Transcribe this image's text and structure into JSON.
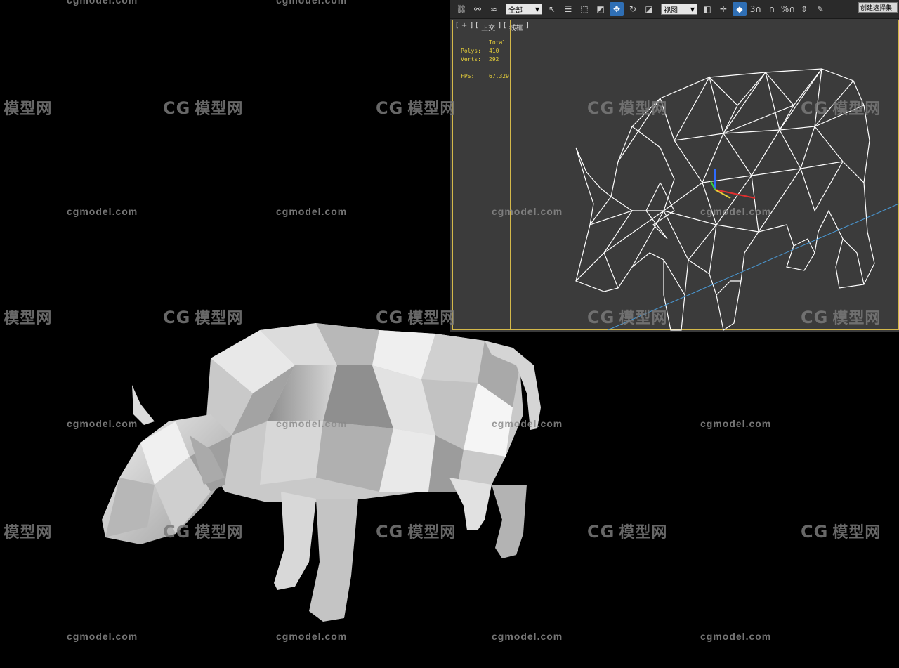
{
  "watermarks": {
    "cn": "模型网",
    "cn_logo": "CG",
    "en": "cgmodel.com"
  },
  "toolbar": {
    "selection_filter": "全部",
    "reference_coord": "视图",
    "snap_angle_label": "3",
    "percent_snap_label": "%",
    "named_selection": "创建选择集"
  },
  "viewport": {
    "label_parts": [
      "[",
      "+",
      "]",
      "[",
      "正交",
      "]",
      "[",
      "线框",
      "]"
    ],
    "stats": {
      "header": "Total",
      "polys_label": "Polys:",
      "polys_value": "410",
      "verts_label": "Verts:",
      "verts_value": "292",
      "fps_label": "FPS:",
      "fps_value": "67.329"
    }
  },
  "colors": {
    "viewport_bg": "#3b3b3b",
    "frame": "#d4b84a",
    "stats_text": "#e6cf3a",
    "active_button": "#2f6fb5",
    "wireframe": "#ffffff"
  }
}
